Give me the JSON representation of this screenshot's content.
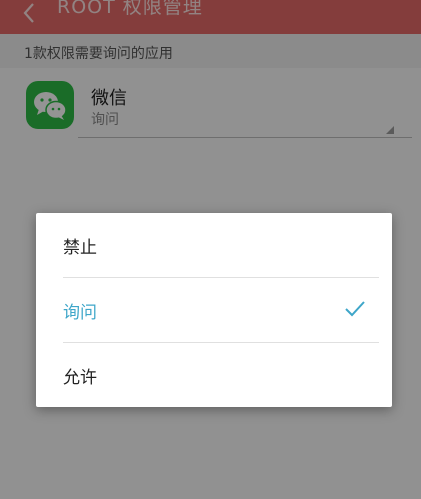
{
  "header": {
    "title": "ROOT 权限管理",
    "back_icon": "chevron-left-icon",
    "bar_color": "#e46a68"
  },
  "section": {
    "label": "1款权限需要询问的应用"
  },
  "apps": [
    {
      "name": "微信",
      "permission": "询问",
      "icon": "wechat-icon",
      "icon_color": "#2dbb46"
    }
  ],
  "dialog": {
    "options": [
      {
        "label": "禁止",
        "selected": false
      },
      {
        "label": "询问",
        "selected": true
      },
      {
        "label": "允许",
        "selected": false
      }
    ],
    "selected_color": "#3ea6c9",
    "check_icon": "checkmark-icon"
  }
}
